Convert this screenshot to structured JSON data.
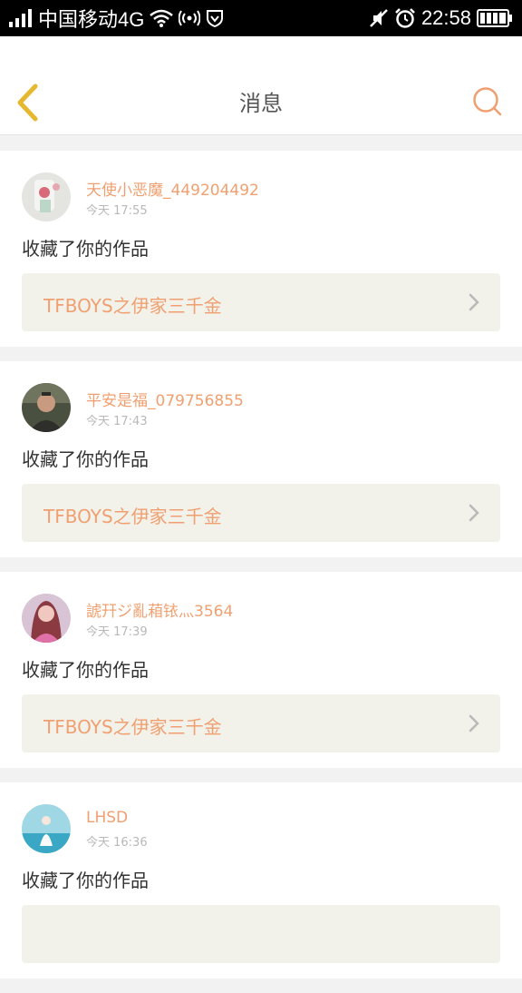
{
  "status_bar": {
    "carrier": "中国移动4G",
    "time": "22:58"
  },
  "header": {
    "title": "消息",
    "back_icon": "chevron-left-icon",
    "search_icon": "search-icon"
  },
  "colors": {
    "accent": "#f0a070",
    "back_arrow": "#e6b830"
  },
  "messages": [
    {
      "user": "天使小恶魔_449204492",
      "time": "今天 17:55",
      "action": "收藏了你的作品",
      "work": "TFBOYS之伊家三千金"
    },
    {
      "user": "平安是福_079756855",
      "time": "今天 17:43",
      "action": "收藏了你的作品",
      "work": "TFBOYS之伊家三千金"
    },
    {
      "user": "諕幵ジ亂葙铱灬3564",
      "time": "今天 17:39",
      "action": "收藏了你的作品",
      "work": "TFBOYS之伊家三千金"
    },
    {
      "user": "LHSD",
      "time": "今天 16:36",
      "action": "收藏了你的作品",
      "work": ""
    }
  ]
}
